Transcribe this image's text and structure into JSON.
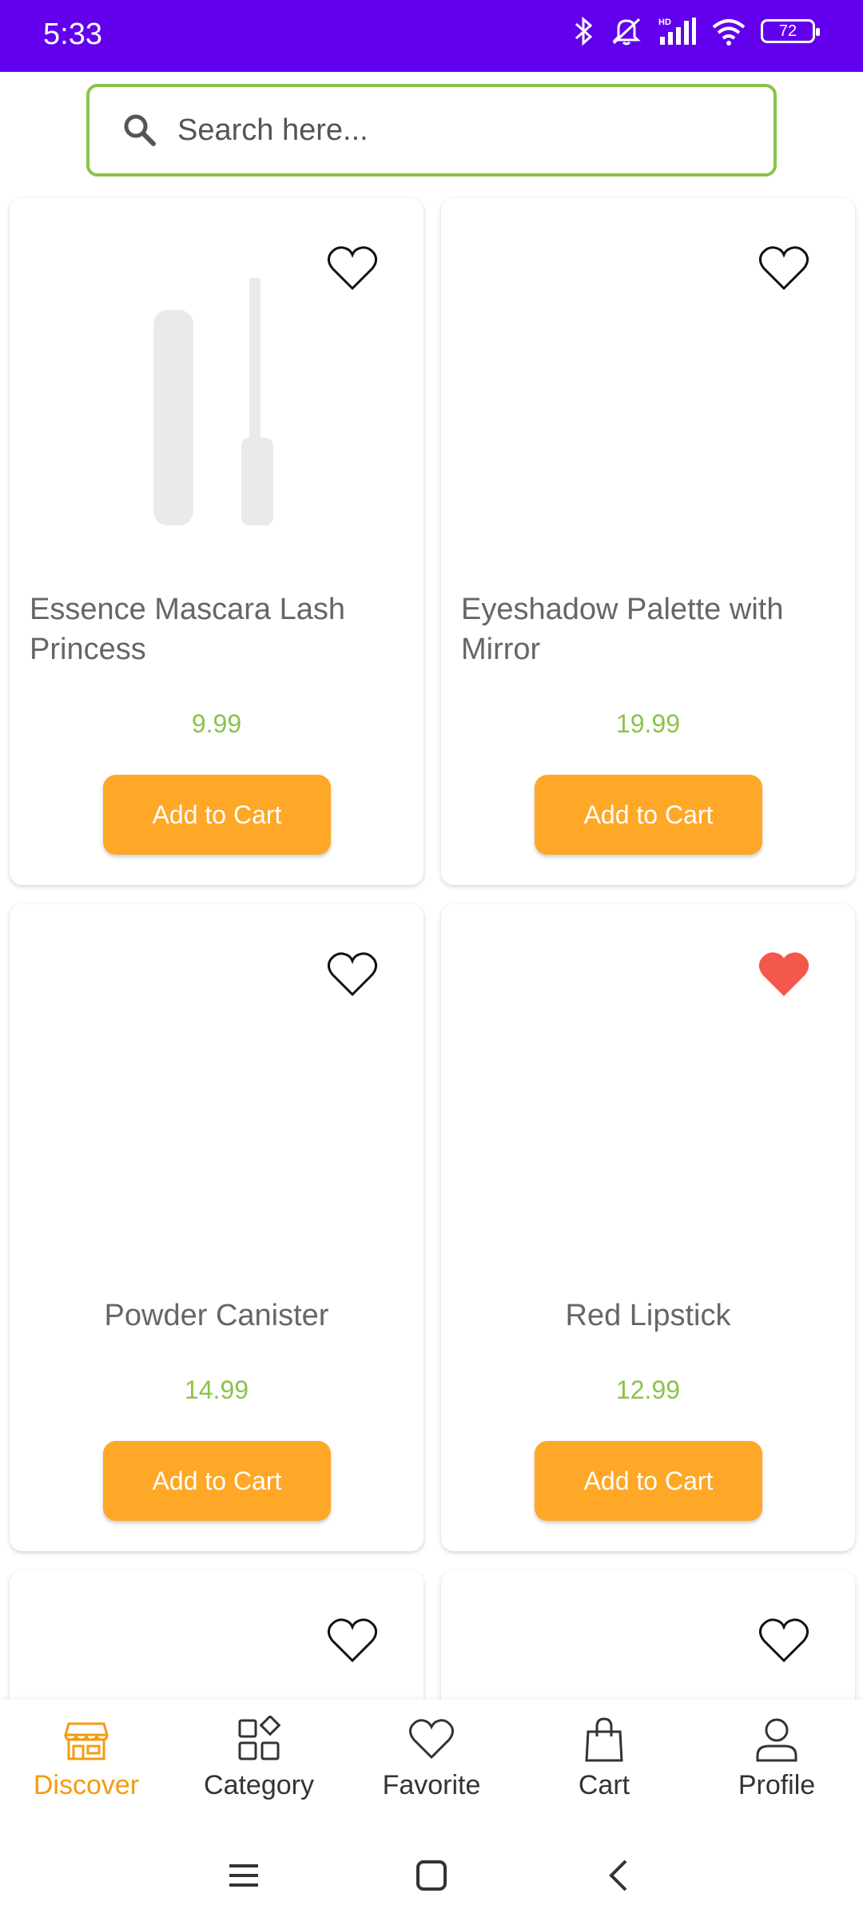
{
  "status_bar": {
    "time": "5:33",
    "battery": "72"
  },
  "search": {
    "placeholder": "Search here..."
  },
  "products": [
    {
      "name": "Essence Mascara Lash Princess",
      "price": "9.99",
      "favorite": false,
      "button": "Add to Cart"
    },
    {
      "name": "Eyeshadow Palette with Mirror",
      "price": "19.99",
      "favorite": false,
      "button": "Add to Cart"
    },
    {
      "name": "Powder Canister",
      "price": "14.99",
      "favorite": false,
      "button": "Add to Cart"
    },
    {
      "name": "Red Lipstick",
      "price": "12.99",
      "favorite": true,
      "button": "Add to Cart"
    }
  ],
  "bottom_nav": [
    {
      "label": "Discover",
      "icon": "store-icon",
      "active": true
    },
    {
      "label": "Category",
      "icon": "category-icon",
      "active": false
    },
    {
      "label": "Favorite",
      "icon": "heart-icon",
      "active": false
    },
    {
      "label": "Cart",
      "icon": "shopping-bag-icon",
      "active": false
    },
    {
      "label": "Profile",
      "icon": "person-icon",
      "active": false
    }
  ],
  "colors": {
    "status_bar": "#6200EE",
    "accent_green": "#8BC34A",
    "button_orange": "#FFA726",
    "active_nav": "#F39C12",
    "favorite_red": "#F4574B"
  }
}
